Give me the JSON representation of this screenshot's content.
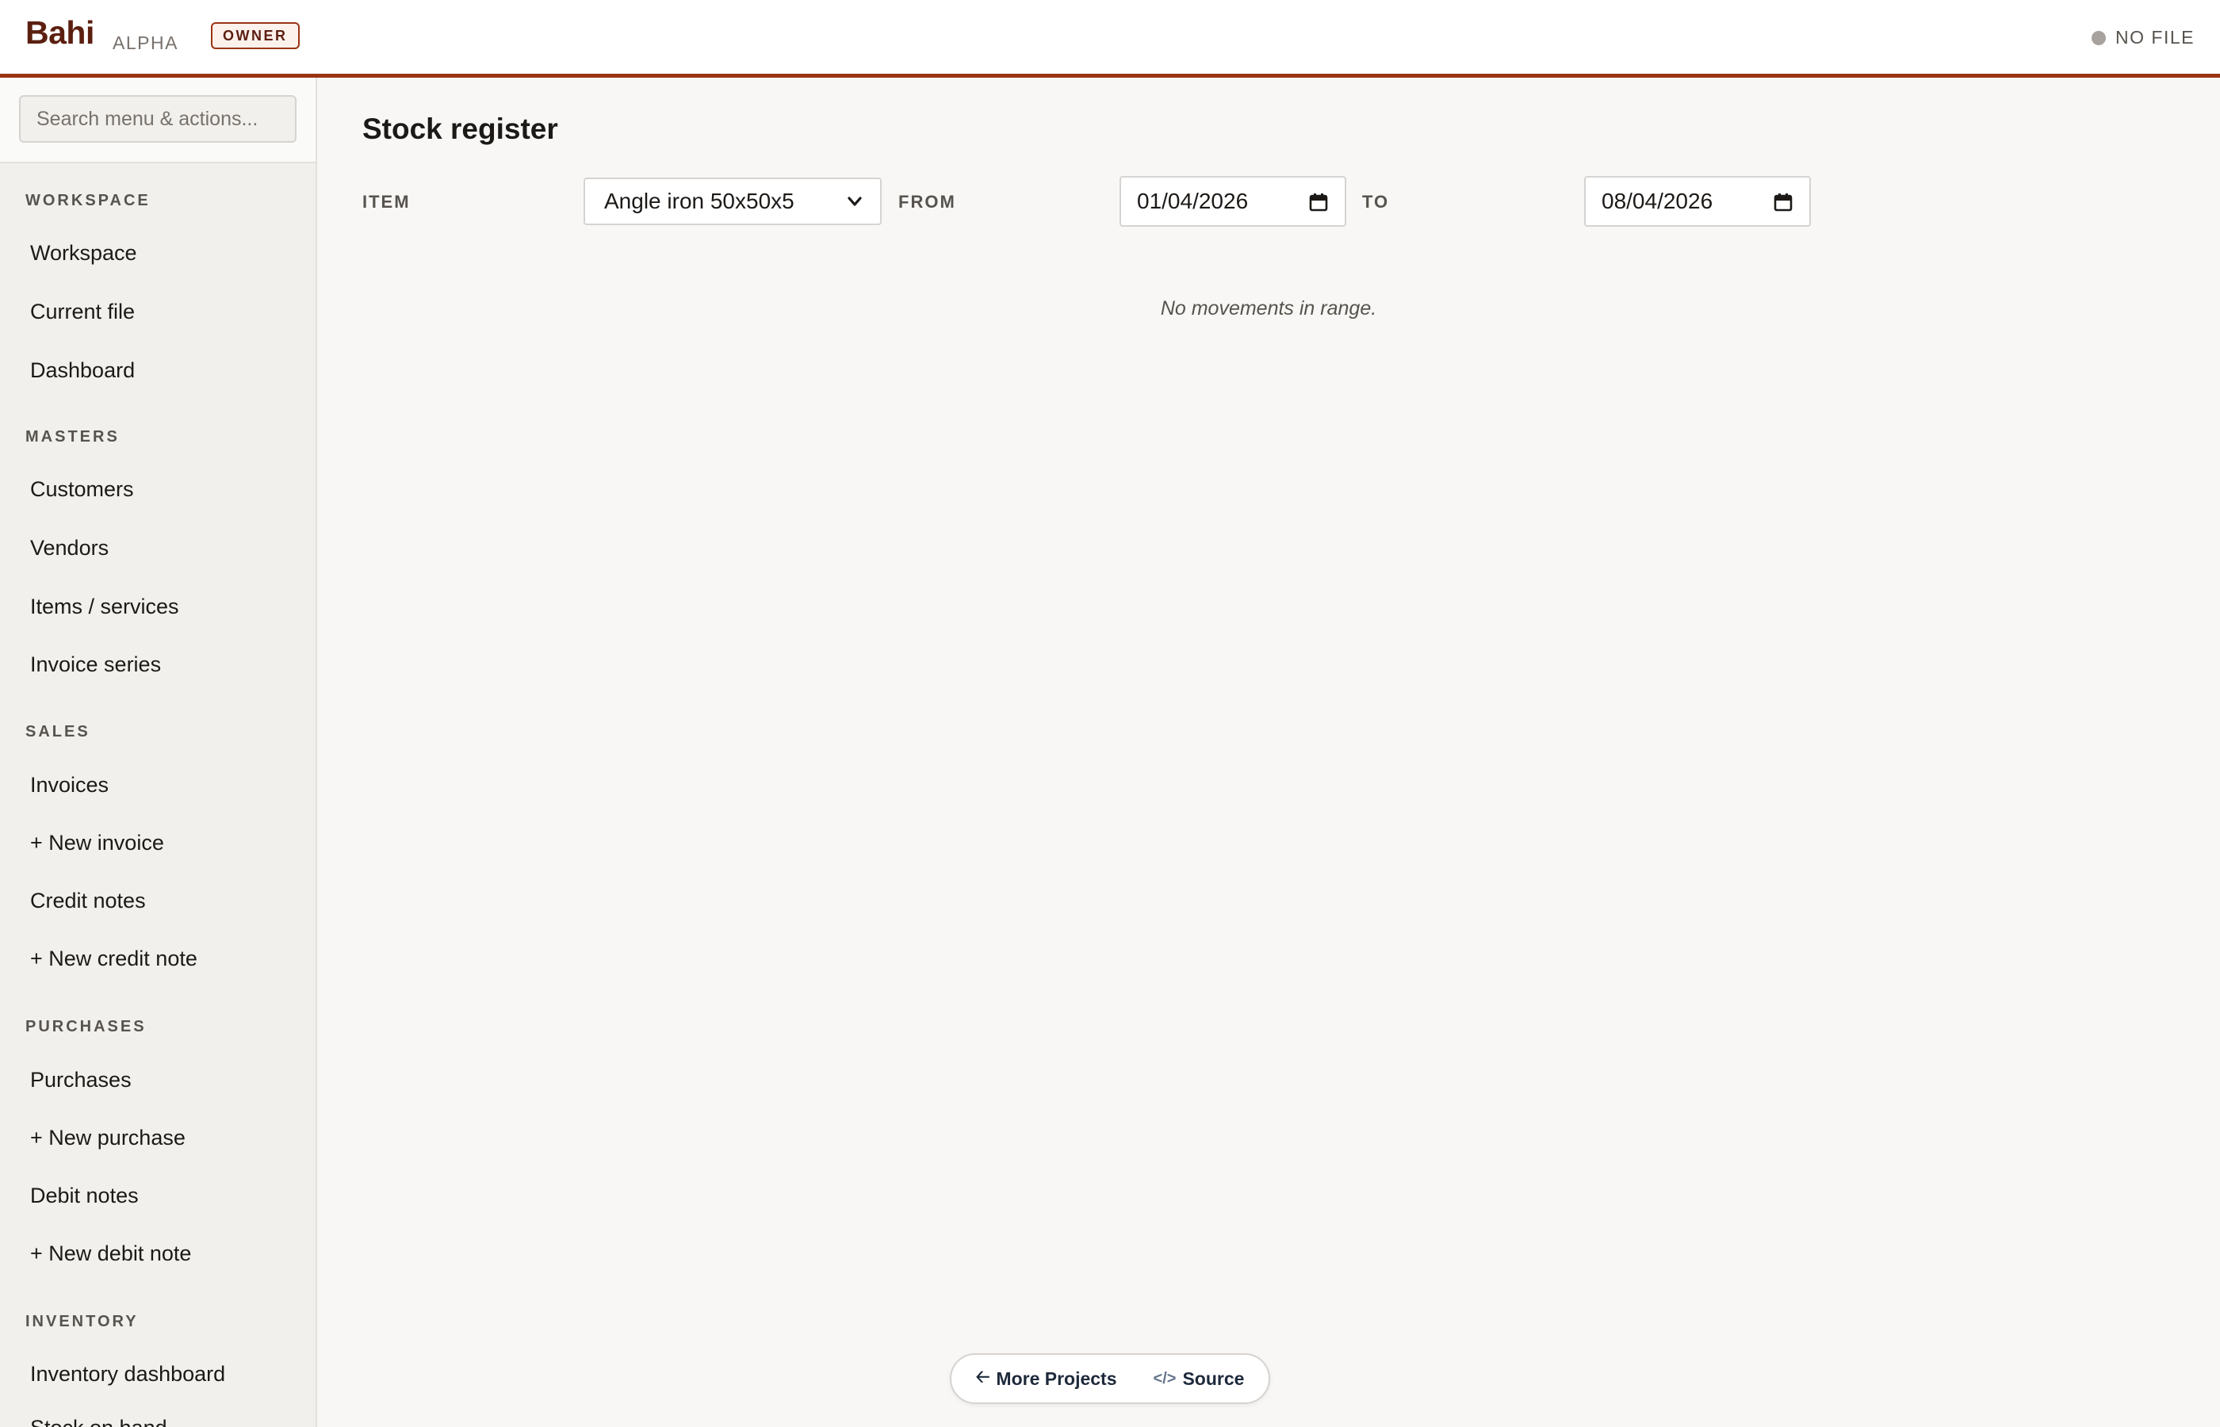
{
  "header": {
    "brand": "Bahi",
    "stage": "ALPHA",
    "role_badge": "OWNER",
    "file_status": "NO FILE"
  },
  "sidebar": {
    "search_placeholder": "Search menu & actions...",
    "sections": [
      {
        "title": "WORKSPACE",
        "items": [
          "Workspace",
          "Current file",
          "Dashboard"
        ]
      },
      {
        "title": "MASTERS",
        "items": [
          "Customers",
          "Vendors",
          "Items / services",
          "Invoice series"
        ]
      },
      {
        "title": "SALES",
        "items": [
          "Invoices",
          "+ New invoice",
          "Credit notes",
          "+ New credit note"
        ]
      },
      {
        "title": "PURCHASES",
        "items": [
          "Purchases",
          "+ New purchase",
          "Debit notes",
          "+ New debit note"
        ]
      },
      {
        "title": "INVENTORY",
        "items": [
          "Inventory dashboard",
          "Stock on hand"
        ]
      }
    ]
  },
  "main": {
    "title": "Stock register",
    "filters": {
      "item_label": "ITEM",
      "item_value": "Angle iron 50x50x5",
      "from_label": "FROM",
      "from_value": "01/04/2026",
      "to_label": "TO",
      "to_value": "08/04/2026"
    },
    "empty_message": "No movements in range."
  },
  "footer_pill": {
    "more_projects": "More Projects",
    "source": "Source"
  }
}
